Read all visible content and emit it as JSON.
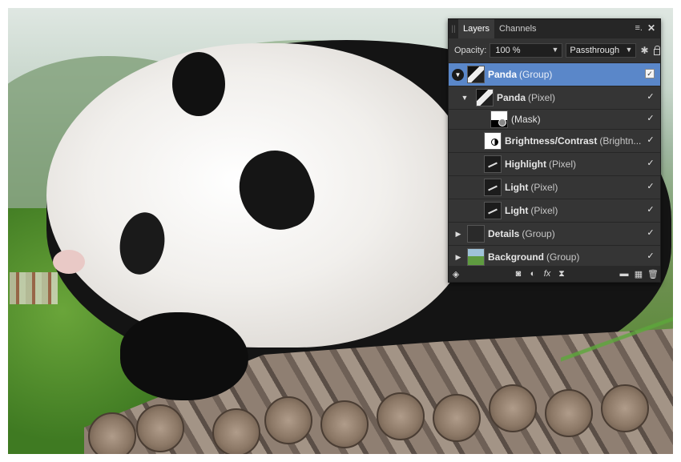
{
  "panel": {
    "tabs": [
      {
        "label": "Layers",
        "active": true
      },
      {
        "label": "Channels",
        "active": false
      }
    ],
    "menu_icon": "hamburger-menu-icon",
    "close_icon": "close-icon",
    "opacity_label": "Opacity:",
    "opacity_value": "100 %",
    "blend_mode": "Passthrough",
    "layers": [
      {
        "name": "Panda",
        "type": "(Group)",
        "selected": true,
        "expanded": true,
        "indent": 0,
        "thumb": "panda",
        "checked": true
      },
      {
        "name": "Panda",
        "type": "(Pixel)",
        "selected": false,
        "expanded": true,
        "indent": 1,
        "thumb": "panda",
        "checked": true
      },
      {
        "name": "",
        "type": "(Mask)",
        "selected": false,
        "indent": 2,
        "thumb": "mask",
        "checked": true
      },
      {
        "name": "Brightness/Contrast",
        "type": "(Brightn...",
        "selected": false,
        "indent": 1,
        "thumb": "bc",
        "checked": true
      },
      {
        "name": "Highlight",
        "type": "(Pixel)",
        "selected": false,
        "indent": 1,
        "thumb": "dark",
        "checked": true
      },
      {
        "name": "Light",
        "type": "(Pixel)",
        "selected": false,
        "indent": 1,
        "thumb": "dark",
        "checked": true
      },
      {
        "name": "Light",
        "type": "(Pixel)",
        "selected": false,
        "indent": 1,
        "thumb": "dark",
        "checked": true
      },
      {
        "name": "Details",
        "type": "(Group)",
        "selected": false,
        "expanded": false,
        "indent": 0,
        "thumb": "details",
        "checked": true
      },
      {
        "name": "Background",
        "type": "(Group)",
        "selected": false,
        "expanded": false,
        "indent": 0,
        "thumb": "bg",
        "checked": true
      }
    ],
    "footer_icons": [
      "layers-stack-icon",
      "mask-icon",
      "adjustment-icon",
      "fx-icon",
      "hourglass-icon",
      "folder-icon",
      "add-layer-icon",
      "trash-icon"
    ]
  }
}
